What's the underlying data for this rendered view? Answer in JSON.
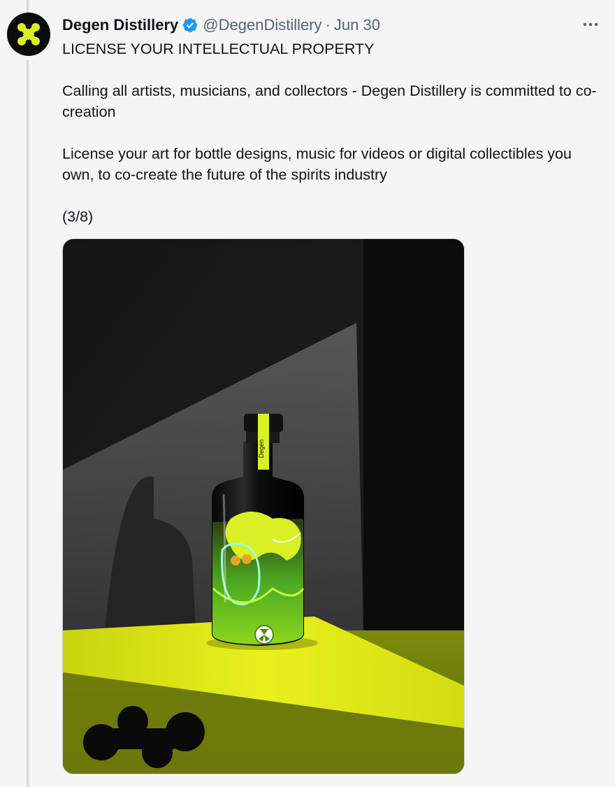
{
  "tweet": {
    "author": {
      "display_name": "Degen Distillery",
      "handle": "@DegenDistillery",
      "verified": true
    },
    "separator": "·",
    "date": "Jun 30",
    "text": {
      "line1": "LICENSE YOUR INTELLECTUAL PROPERTY",
      "line2": "Calling all artists, musicians, and collectors - Degen Distillery is committed to co-creation",
      "line3": "License your art for bottle designs, music for videos or digital collectibles you own, to co-create the future of the spirits industry",
      "line4": "(3/8)"
    },
    "media": {
      "bottle_label": "Degen"
    }
  },
  "icons": {
    "avatar": "degen-x-logo-icon",
    "verified": "verified-badge-icon",
    "more": "more-dots-icon"
  },
  "colors": {
    "accent_lime": "#d7f126",
    "verified_blue": "#1d9bf0",
    "text_primary": "#0f1419",
    "text_secondary": "#536471"
  }
}
